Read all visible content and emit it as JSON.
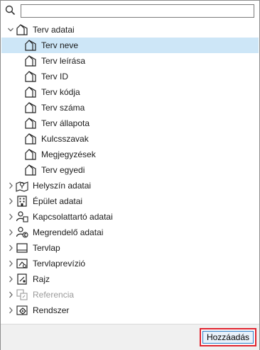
{
  "search": {
    "value": "",
    "placeholder": ""
  },
  "tree": {
    "root": {
      "label": "Terv adatai",
      "icon": "house-icon",
      "expanded": true
    },
    "children": [
      {
        "label": "Terv neve",
        "selected": true
      },
      {
        "label": "Terv leírása"
      },
      {
        "label": "Terv ID"
      },
      {
        "label": "Terv kódja"
      },
      {
        "label": "Terv száma"
      },
      {
        "label": "Terv állapota"
      },
      {
        "label": "Kulcsszavak"
      },
      {
        "label": "Megjegyzések"
      },
      {
        "label": "Terv egyedi"
      }
    ],
    "groups": [
      {
        "label": "Helyszín adatai",
        "icon": "map-pin-icon",
        "disabled": false
      },
      {
        "label": "Épület adatai",
        "icon": "building-icon",
        "disabled": false
      },
      {
        "label": "Kapcsolattartó adatai",
        "icon": "contact-icon",
        "disabled": false
      },
      {
        "label": "Megrendelő adatai",
        "icon": "client-icon",
        "disabled": false
      },
      {
        "label": "Tervlap",
        "icon": "layout-sheet-icon",
        "disabled": false
      },
      {
        "label": "Tervlaprevízió",
        "icon": "sheet-revision-icon",
        "disabled": false
      },
      {
        "label": "Rajz",
        "icon": "drawing-icon",
        "disabled": false
      },
      {
        "label": "Referencia",
        "icon": "reference-icon",
        "disabled": true
      },
      {
        "label": "Rendszer",
        "icon": "system-gear-icon",
        "disabled": false
      }
    ]
  },
  "footer": {
    "add_label": "Hozzáadás"
  },
  "colors": {
    "selection": "#cde6f7",
    "highlight_border": "#e0242f",
    "button_border": "#2c7fc7"
  }
}
